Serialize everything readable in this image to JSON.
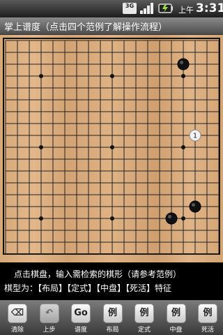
{
  "statusbar": {
    "network_label": "3G",
    "ampm": "上午",
    "time": "3:31",
    "icons": [
      "3g-data-icon",
      "signal-strength-icon",
      "battery-icon"
    ]
  },
  "titlebar": {
    "title": "掌上谱度（点击四个范例了解操作流程）"
  },
  "board": {
    "size": 19,
    "star_points": [
      [
        3,
        3
      ],
      [
        9,
        3
      ],
      [
        15,
        3
      ],
      [
        3,
        9
      ],
      [
        9,
        9
      ],
      [
        15,
        9
      ],
      [
        3,
        15
      ],
      [
        9,
        15
      ],
      [
        15,
        15
      ]
    ],
    "stones": [
      {
        "col": 15,
        "row": 2,
        "color": "black"
      },
      {
        "col": 16,
        "row": 8,
        "color": "white",
        "number": "1"
      },
      {
        "col": 16,
        "row": 14,
        "color": "black"
      },
      {
        "col": 14,
        "row": 15,
        "color": "black"
      }
    ]
  },
  "info": {
    "line1": "点击棋盘，输入需检索的棋形（请参考范例）",
    "line2": "棋型为：【布局】【定式】【中盘】【死活】特征"
  },
  "toolbar": {
    "buttons": [
      {
        "id": "clear",
        "glyph": "⌫",
        "label": "清除",
        "disabled": false
      },
      {
        "id": "undo",
        "glyph": "↶",
        "label": "上步",
        "disabled": true
      },
      {
        "id": "go",
        "glyph": "Go",
        "label": "谱度",
        "disabled": false
      },
      {
        "id": "opening",
        "glyph": "例",
        "label": "布局",
        "disabled": false
      },
      {
        "id": "joseki",
        "glyph": "例",
        "label": "定式",
        "disabled": false
      },
      {
        "id": "middle",
        "glyph": "例",
        "label": "中盘",
        "disabled": false
      },
      {
        "id": "lifedeath",
        "glyph": "例",
        "label": "死活",
        "disabled": false
      }
    ]
  }
}
